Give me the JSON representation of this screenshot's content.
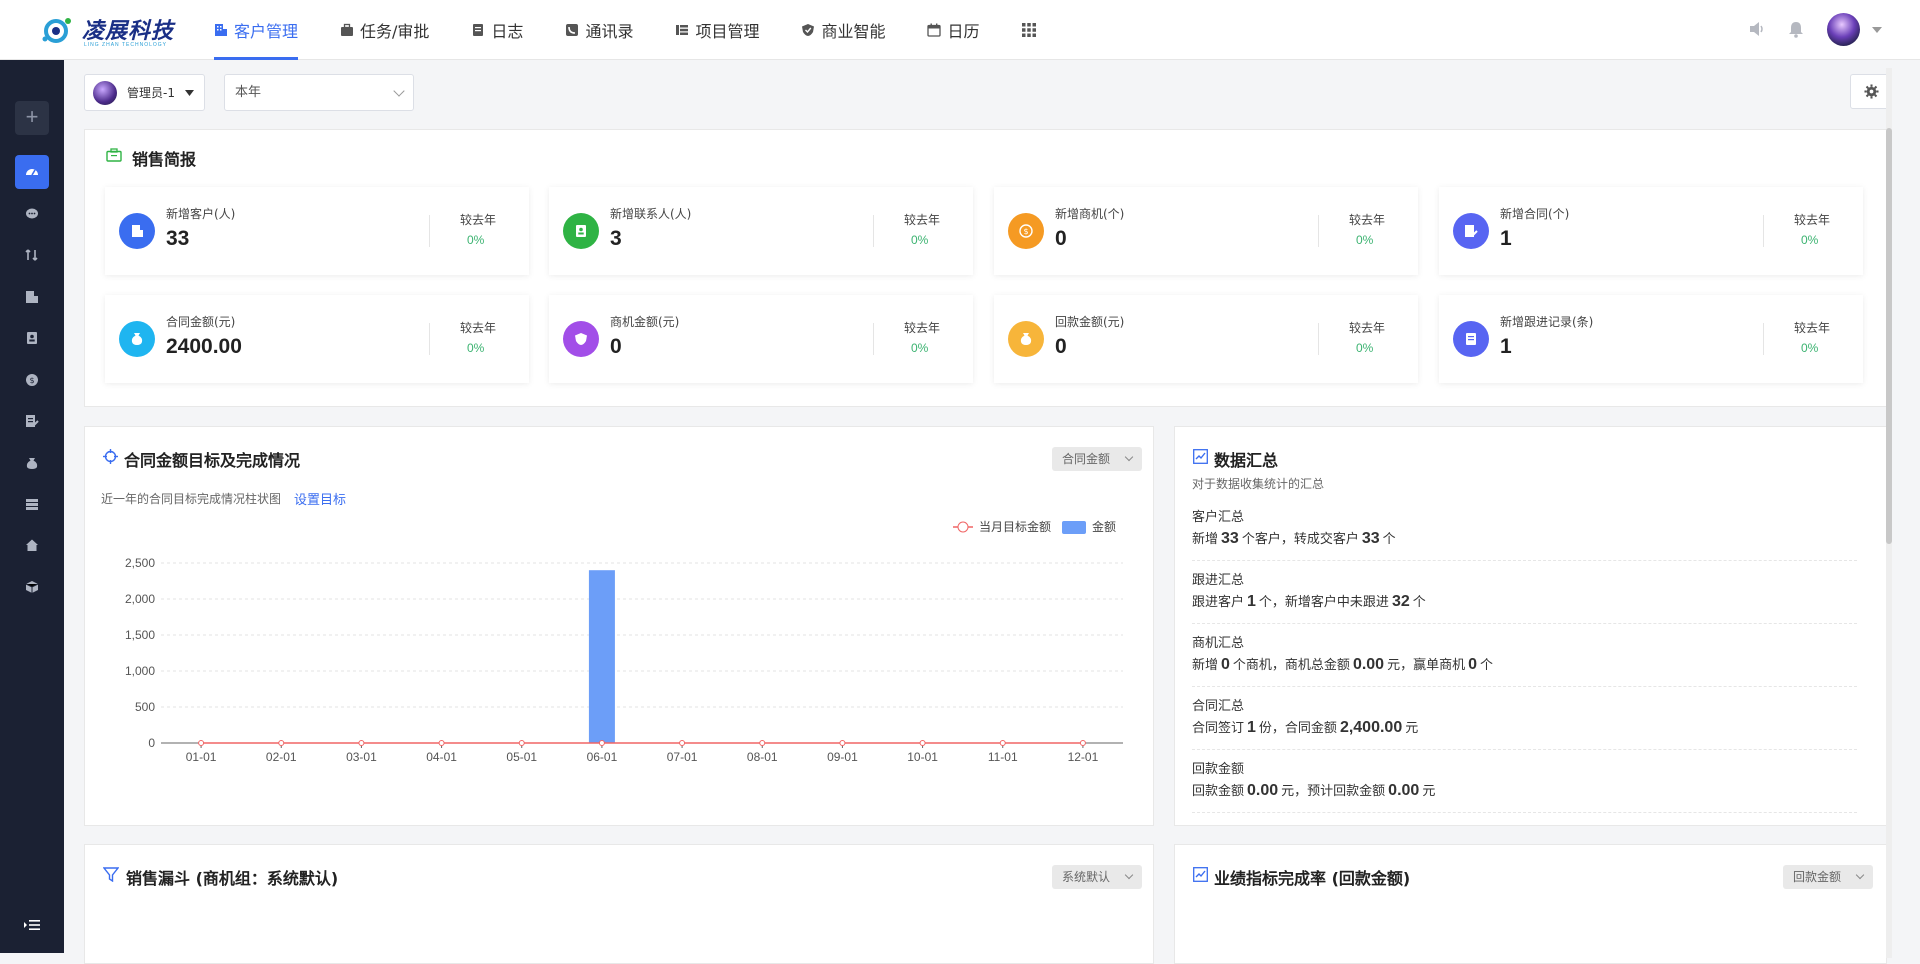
{
  "app": {
    "logo_text": "凌展科技",
    "logo_subtext": "LING ZHAN TECHNOLOGY"
  },
  "nav": [
    {
      "label": "客户管理",
      "icon": "building-icon",
      "active": true
    },
    {
      "label": "任务/审批",
      "icon": "briefcase-icon",
      "active": false
    },
    {
      "label": "日志",
      "icon": "notebook-icon",
      "active": false
    },
    {
      "label": "通讯录",
      "icon": "phone-icon",
      "active": false
    },
    {
      "label": "项目管理",
      "icon": "project-icon",
      "active": false
    },
    {
      "label": "商业智能",
      "icon": "shield-check-icon",
      "active": false
    },
    {
      "label": "日历",
      "icon": "calendar-icon",
      "active": false
    }
  ],
  "filters": {
    "user": "管理员-1",
    "period": "本年"
  },
  "sales_brief": {
    "title": "销售简报",
    "compare_label": "较去年",
    "cards": [
      {
        "label": "新增客户(人)",
        "value": "33",
        "pct": "0%",
        "color": "#3a6df0",
        "icon": "building-icon"
      },
      {
        "label": "新增联系人(人)",
        "value": "3",
        "pct": "0%",
        "color": "#2fb344",
        "icon": "contact-card-icon"
      },
      {
        "label": "新增商机(个)",
        "value": "0",
        "pct": "0%",
        "color": "#f59a23",
        "icon": "dollar-coin-icon"
      },
      {
        "label": "新增合同(个)",
        "value": "1",
        "pct": "0%",
        "color": "#5865f2",
        "icon": "contract-icon"
      },
      {
        "label": "合同金额(元)",
        "value": "2400.00",
        "pct": "0%",
        "color": "#1fb5f0",
        "icon": "money-bag-icon"
      },
      {
        "label": "商机金额(元)",
        "value": "0",
        "pct": "0%",
        "color": "#a24ee8",
        "icon": "shield-icon"
      },
      {
        "label": "回款金额(元)",
        "value": "0",
        "pct": "0%",
        "color": "#f7b53a",
        "icon": "money-bag-icon"
      },
      {
        "label": "新增跟进记录(条)",
        "value": "1",
        "pct": "0%",
        "color": "#5865f2",
        "icon": "list-doc-icon"
      }
    ]
  },
  "contract_chart": {
    "title": "合同金额目标及完成情况",
    "select": "合同金额",
    "subtitle": "近一年的合同目标完成情况柱状图",
    "set_target_link": "设置目标"
  },
  "chart_data": {
    "type": "bar",
    "categories": [
      "01-01",
      "02-01",
      "03-01",
      "04-01",
      "05-01",
      "06-01",
      "07-01",
      "08-01",
      "09-01",
      "10-01",
      "11-01",
      "12-01"
    ],
    "series": [
      {
        "name": "当月目标金额",
        "type": "line",
        "values": [
          0,
          0,
          0,
          0,
          0,
          0,
          0,
          0,
          0,
          0,
          0,
          0
        ],
        "color": "#f06565"
      },
      {
        "name": "金额",
        "type": "bar",
        "values": [
          0,
          0,
          0,
          0,
          0,
          2400,
          0,
          0,
          0,
          0,
          0,
          0
        ],
        "color": "#6c9ef8"
      }
    ],
    "yticks": [
      "2,500",
      "2,000",
      "1,500",
      "1,000",
      "500",
      "0"
    ],
    "ylim": [
      0,
      2500
    ],
    "grid": true,
    "legend": "top-right"
  },
  "data_summary": {
    "title": "数据汇总",
    "subtitle": "对于数据收集统计的汇总",
    "items": [
      {
        "title": "客户汇总",
        "parts": [
          "新增",
          "33",
          "个客户，转成交客户",
          "33",
          "个"
        ]
      },
      {
        "title": "跟进汇总",
        "parts": [
          "跟进客户",
          "1",
          "个，新增客户中未跟进",
          "32",
          "个"
        ]
      },
      {
        "title": "商机汇总",
        "parts": [
          "新增",
          "0",
          "个商机，商机总金额",
          "0.00",
          "元，赢单商机",
          "0",
          "个"
        ]
      },
      {
        "title": "合同汇总",
        "parts": [
          "合同签订",
          "1",
          "份，合同金额",
          "2,400.00",
          "元"
        ]
      },
      {
        "title": "回款金额",
        "parts": [
          "回款金额",
          "0.00",
          "元，预计回款金额",
          "0.00",
          "元"
        ]
      }
    ]
  },
  "funnel": {
    "title": "销售漏斗 (商机组：系统默认)",
    "select": "系统默认"
  },
  "performance": {
    "title": "业绩指标完成率 (回款金额)",
    "select": "回款金额"
  }
}
